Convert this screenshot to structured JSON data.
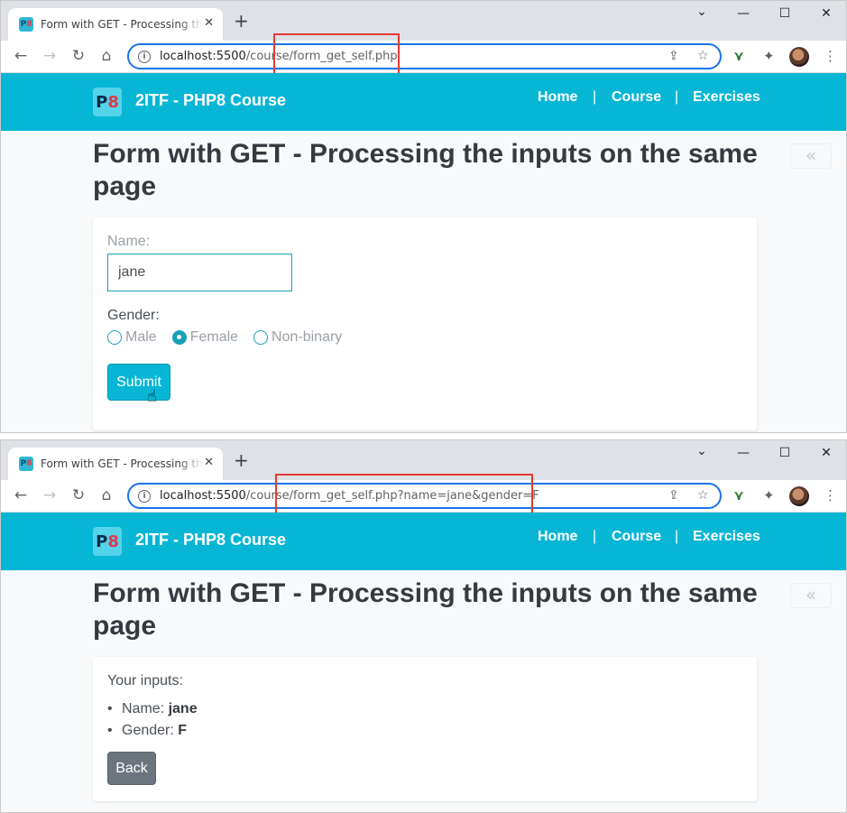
{
  "browser": {
    "tab_title": "Form with GET - Processing the inputs on the same page",
    "new_tab": "+",
    "close": "✕",
    "minimize": "—",
    "maximize": "☐",
    "close_window": "✕",
    "chevron": "⌄",
    "nav": {
      "back": "←",
      "forward": "→",
      "reload": "↻",
      "home": "⌂"
    }
  },
  "window1": {
    "url_host": "localhost:5500",
    "url_path": "/course/form_get_self.php"
  },
  "window2": {
    "url_host": "localhost:5500",
    "url_path": "/course/form_get_self.php?name=jane&gender=F"
  },
  "site": {
    "logo_p": "P",
    "logo_8": "8",
    "brand": "2ITF - PHP8 Course",
    "menu": [
      "Home",
      "Course",
      "Exercises"
    ],
    "separator": "|"
  },
  "page": {
    "title": "Form with GET - Processing the inputs on the same page",
    "back_chevron": "«"
  },
  "form": {
    "name_label": "Name:",
    "name_value": "jane",
    "gender_label": "Gender:",
    "gender_options": [
      "Male",
      "Female",
      "Non-binary"
    ],
    "selected_gender": "Female",
    "submit_label": "Submit"
  },
  "result": {
    "heading": "Your inputs:",
    "name_label": "Name:",
    "name_value": "jane",
    "gender_label": "Gender:",
    "gender_value": "F",
    "back_label": "Back"
  },
  "colors": {
    "navbar": "#07b6d5",
    "highlight": "#e53935",
    "secondary_button": "#6c757d"
  },
  "icons": [
    "info-icon",
    "share-icon",
    "star-icon",
    "extension-icon",
    "avatar",
    "menu-dots-icon",
    "hand-cursor-icon"
  ]
}
